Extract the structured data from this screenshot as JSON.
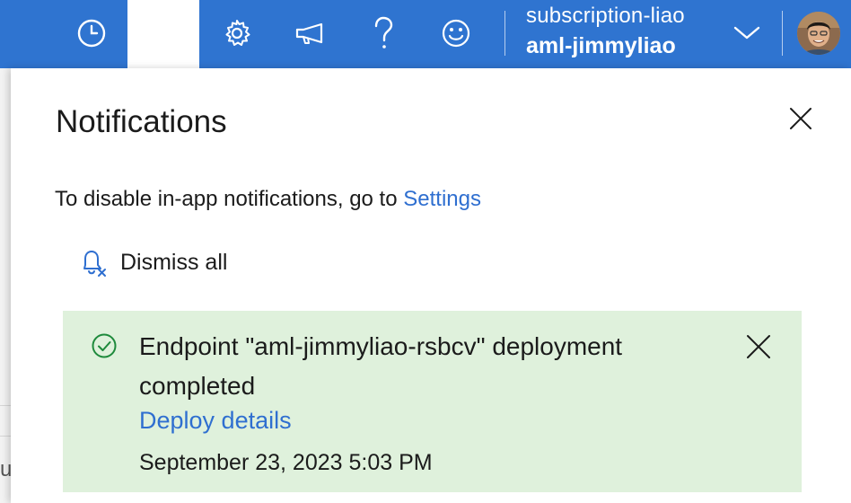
{
  "header": {
    "account": {
      "subscription": "subscription-liao",
      "workspace": "aml-jimmyliao"
    },
    "icons": [
      "clock-icon",
      "gear-icon",
      "megaphone-icon",
      "question-icon",
      "smiley-icon",
      "chevron-down-icon"
    ],
    "colors": {
      "bar": "#2f74d0"
    }
  },
  "panel": {
    "title": "Notifications",
    "info_text": "To disable in-app notifications, go to ",
    "settings_link": "Settings",
    "dismiss_all": "Dismiss all"
  },
  "notifications": [
    {
      "status": "success",
      "message": "Endpoint \"aml-jimmyliao-rsbcv\" deployment completed",
      "link": "Deploy details",
      "timestamp": "September 23, 2023 5:03 PM",
      "background": "#dff1dc"
    }
  ],
  "underlying": {
    "partial_char": "u"
  }
}
